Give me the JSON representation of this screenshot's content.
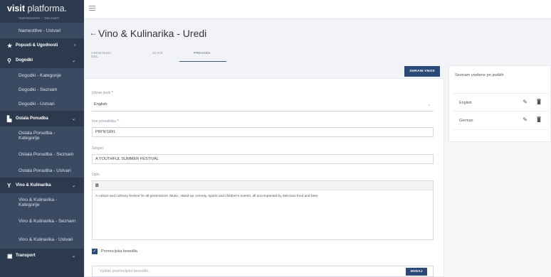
{
  "app": {
    "logo_bold": "visit",
    "logo_rest": " platforma."
  },
  "sidebar": {
    "top_cut": "Namestitve - Seznam",
    "items": [
      {
        "label": "Namestitve - Ustvari",
        "type": "sub"
      },
      {
        "label": "Popusti & Ugodnosti",
        "type": "cat",
        "icon": "star-icon",
        "chevron": "›"
      },
      {
        "label": "Dogodki",
        "type": "cat",
        "icon": "pin-icon",
        "chevron": "⌄"
      },
      {
        "label": "Dogodki - Kategorije",
        "type": "sub"
      },
      {
        "label": "Dogodki - Seznam",
        "type": "sub"
      },
      {
        "label": "Dogodki - Ustvari",
        "type": "sub"
      },
      {
        "label": "Ostala Ponudba",
        "type": "cat",
        "icon": "building-icon",
        "chevron": "⌄"
      },
      {
        "label": "Ostala Ponudba - Kategorije",
        "type": "sub"
      },
      {
        "label": "Ostala Ponudba - Seznam",
        "type": "sub"
      },
      {
        "label": "Ostala Ponudba - Ustvari",
        "type": "sub"
      },
      {
        "label": "Vino & Kulinarika",
        "type": "cat",
        "icon": "wine-glass-icon",
        "chevron": "⌄"
      },
      {
        "label": "Vino & Kulinarika - Kategorije",
        "type": "sub"
      },
      {
        "label": "Vino & Kulinarika - Seznam",
        "type": "sub"
      },
      {
        "label": "Vino & Kulinarika - Ustvari",
        "type": "sub"
      },
      {
        "label": "Transport",
        "type": "cat",
        "icon": "bus-icon",
        "chevron": "⌄"
      }
    ]
  },
  "header": {
    "back_arrow": "←",
    "title": "Vino & Kulinarika - Uredi",
    "tabs": [
      {
        "label": "VSEBINSKI DEL",
        "active": false
      },
      {
        "label": "SLIKE",
        "active": false
      },
      {
        "label": "PREVODI",
        "active": true
      }
    ]
  },
  "form": {
    "save_label": "SHRANI VNOS",
    "language_label": "Izbran jezik",
    "language_value": "English",
    "name_label": "Ime ponudnika",
    "name_value": "PIR'N'GRIL",
    "slogan_label": "Slogan",
    "slogan_value": "A YOUTHFUL SUMMER FESTIVAL",
    "description_label": "Opis",
    "bold_button": "B",
    "description_value": "A culture and culinary festival for all generations. Music, stand-up comedy, sports and children's events, all accompanied by delicious food and beer.",
    "promo_checkbox_label": "Promocijska besedila",
    "promo_placeholder": "Vpišite promocijsko besedilo...",
    "add_label": "DODAJ",
    "required_mark": "*"
  },
  "side_panel": {
    "title": "Seznam vsebine po jezikih",
    "languages": [
      "English",
      "German"
    ]
  },
  "colors": {
    "sidebar_bg": "#2d3a4e",
    "primary": "#2b4a78"
  }
}
